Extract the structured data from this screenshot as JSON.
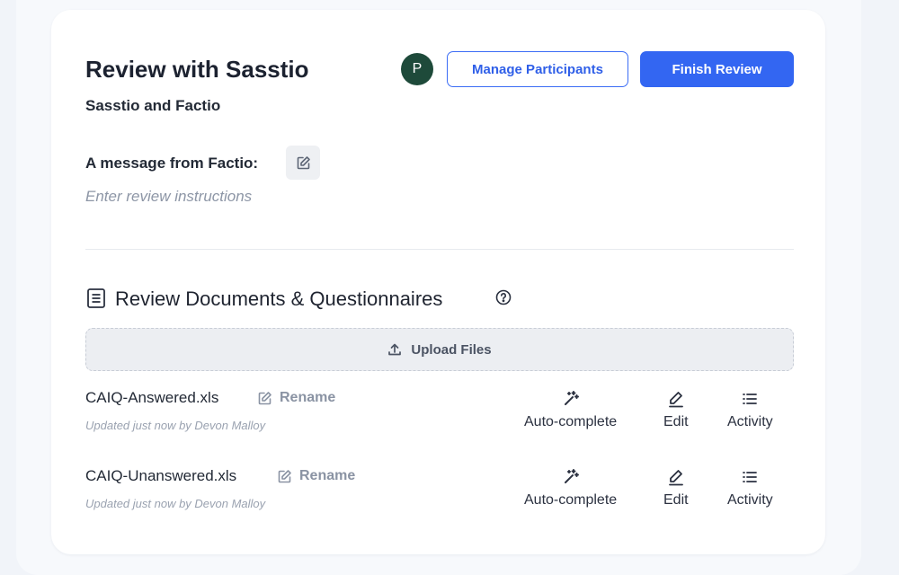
{
  "review": {
    "title": "Review with Sasstio",
    "subtitle": "Sasstio and Factio",
    "avatar_initial": "P",
    "manage_participants_label": "Manage Participants",
    "finish_review_label": "Finish Review",
    "message_label": "A message from Factio:",
    "instructions_placeholder": "Enter review instructions"
  },
  "documents": {
    "section_title": "Review Documents & Questionnaires",
    "upload_label": "Upload Files",
    "files": [
      {
        "name": "CAIQ-Answered.xls",
        "rename_label": "Rename",
        "updated": "Updated just now by Devon Malloy",
        "actions": {
          "autocomplete": "Auto-complete",
          "edit": "Edit",
          "activity": "Activity"
        }
      },
      {
        "name": "CAIQ-Unanswered.xls",
        "rename_label": "Rename",
        "updated": "Updated just now by Devon Malloy",
        "actions": {
          "autocomplete": "Auto-complete",
          "edit": "Edit",
          "activity": "Activity"
        }
      }
    ]
  },
  "colors": {
    "accent": "#3366f2",
    "avatar_bg": "#1e4a3a",
    "card_bg": "#ffffff",
    "page_bg": "#f1f4f9"
  },
  "icons": [
    "edit-icon",
    "document-icon",
    "help-icon",
    "upload-icon",
    "magic-wand-icon",
    "pencil-icon",
    "list-icon"
  ]
}
